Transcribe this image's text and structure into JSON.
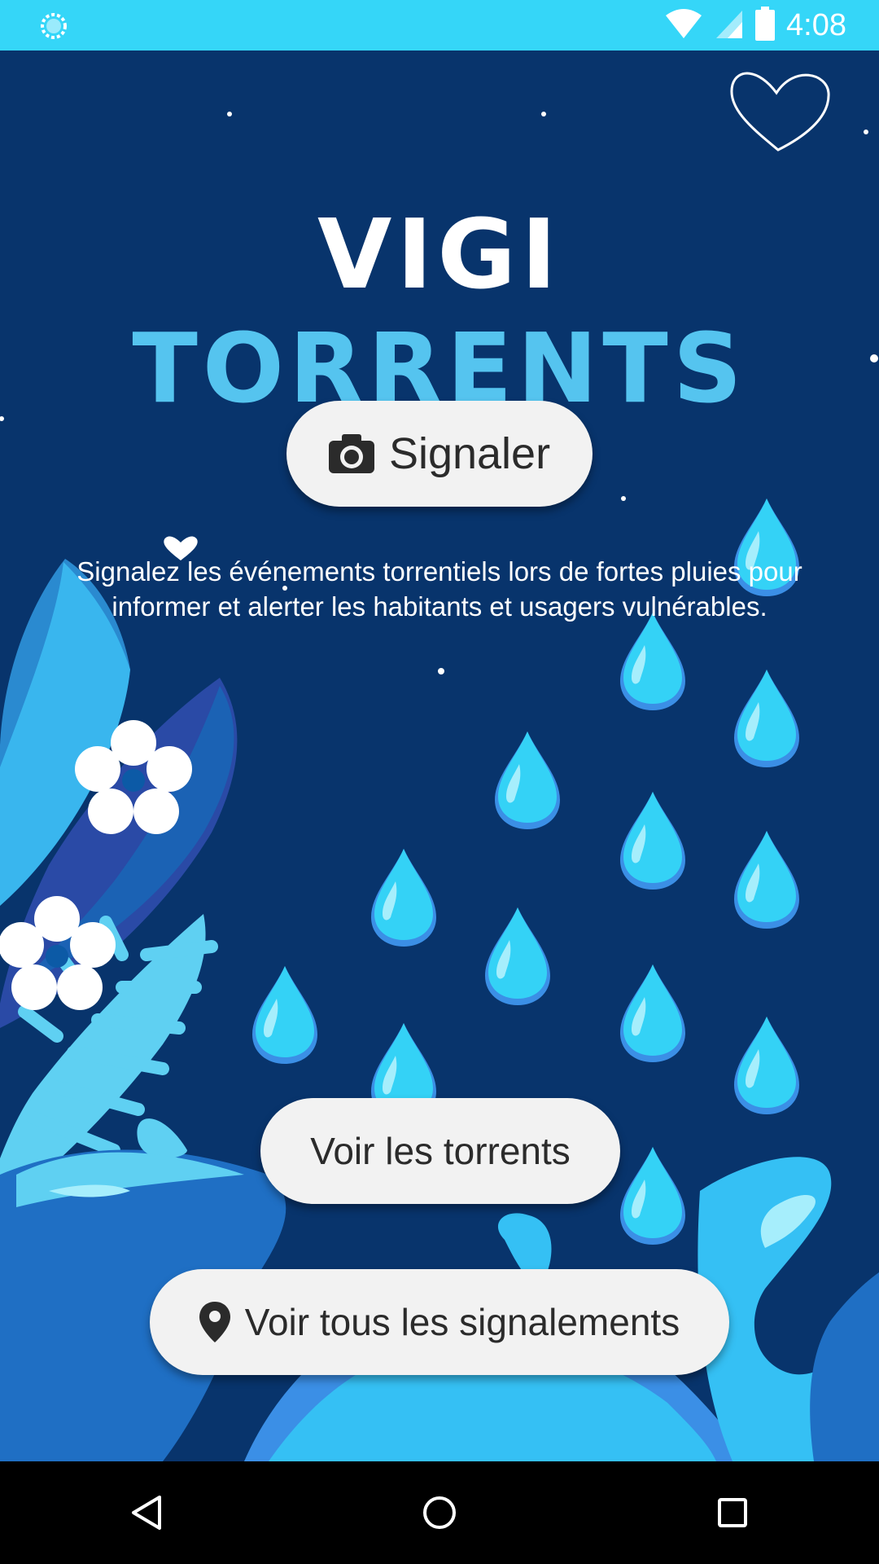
{
  "status_bar": {
    "time": "4:08",
    "icons": [
      "sync-icon",
      "wifi-icon",
      "cell-signal-icon",
      "battery-icon"
    ]
  },
  "app": {
    "title_part1": "VIGI",
    "title_part2": "TORRENTS",
    "description": "Signalez les événements torrentiels lors de fortes pluies pour informer et alerter les habitants et usagers vulnérables.",
    "buttons": {
      "signaler": "Signaler",
      "voir_torrents": "Voir les torrents",
      "voir_signalements": "Voir tous les signalements"
    }
  },
  "navigation": {
    "icons": [
      "back-icon",
      "home-icon",
      "recents-icon"
    ]
  },
  "colors": {
    "status_bar": "#35d6f8",
    "background": "#08346c",
    "title_accent": "#55c4ef",
    "button": "#f2f2f2"
  }
}
